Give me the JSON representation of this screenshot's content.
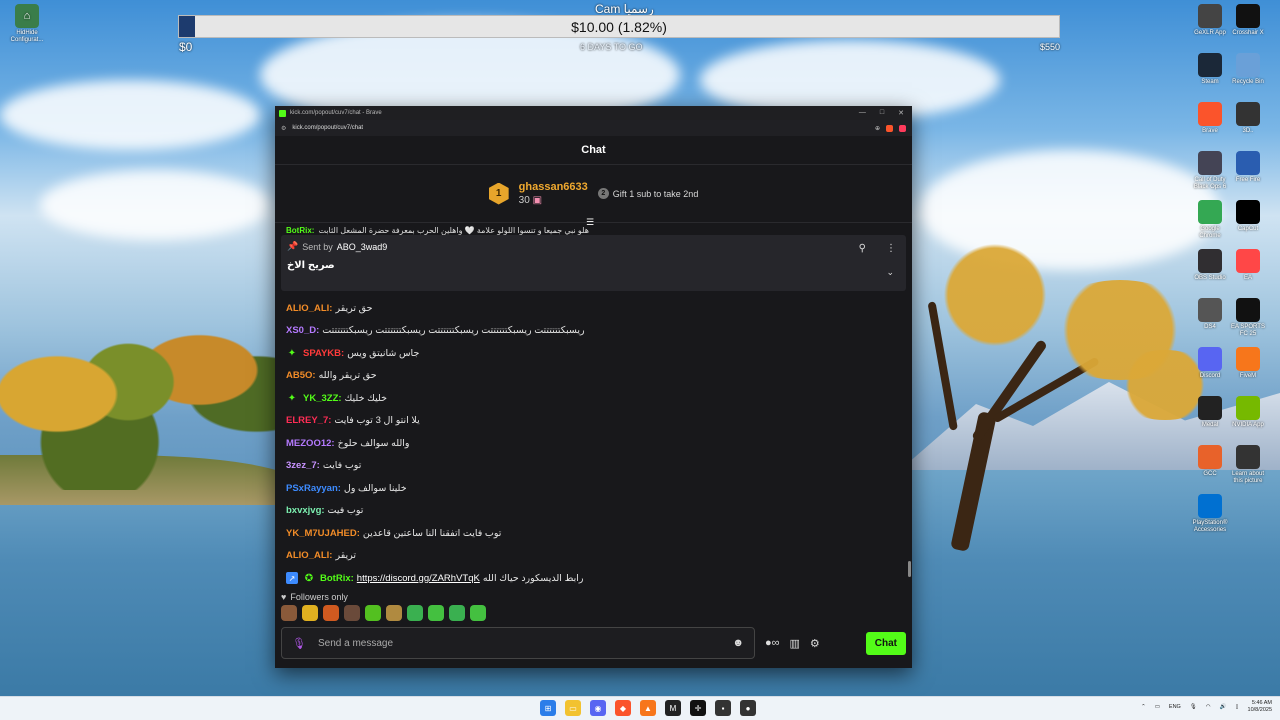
{
  "donation": {
    "title": "Cam رسميا",
    "amount_label": "$10.00 (1.82%)",
    "progress_fraction": 0.0182,
    "min_label": "$0",
    "max_label": "$550",
    "sub_label": "6 DAYS TO GO"
  },
  "desktop_left": {
    "hidhide": "HidHide Configurat..."
  },
  "desktop_right": [
    {
      "label": "GeXLR App",
      "color": "#444"
    },
    {
      "label": "Crosshair X",
      "color": "#111"
    },
    {
      "label": "Steam",
      "color": "#1b2838"
    },
    {
      "label": "Recycle Bin",
      "color": "#6aa0d8"
    },
    {
      "label": "Brave",
      "color": "#fb542b"
    },
    {
      "label": "3D..",
      "color": "#333"
    },
    {
      "label": "Call of Duty Black Ops 6",
      "color": "#445"
    },
    {
      "label": "Free Fire",
      "color": "#2a5db0"
    },
    {
      "label": "Google Chrome",
      "color": "#34a853"
    },
    {
      "label": "CapCut",
      "color": "#000"
    },
    {
      "label": "OBS Studio",
      "color": "#302e31"
    },
    {
      "label": "EA",
      "color": "#ff4747"
    },
    {
      "label": "DS4",
      "color": "#555"
    },
    {
      "label": "EA SPORTS FC 25",
      "color": "#111"
    },
    {
      "label": "Discord",
      "color": "#5865f2"
    },
    {
      "label": "FiveM",
      "color": "#f7761b"
    },
    {
      "label": "Medal",
      "color": "#222"
    },
    {
      "label": "NVIDIA App",
      "color": "#76b900"
    },
    {
      "label": "GCC",
      "color": "#e8622a"
    },
    {
      "label": "Learn about this picture",
      "color": "#333"
    },
    {
      "label": "PlayStation® Accessories",
      "color": "#0070d1"
    }
  ],
  "browser": {
    "title": "kick.com/popout/cuv7/chat - Brave",
    "url": "kick.com/popout/cuv7/chat"
  },
  "chat": {
    "header": "Chat",
    "leader": {
      "rank": "1",
      "name": "ghassan6633",
      "count": "30"
    },
    "gift": {
      "num": "2",
      "text": "Gift 1 sub to take 2nd"
    },
    "cutoff_user": "BotRix:",
    "cutoff_text": "هلو نبي جميعا و تنسوا اللولو علامة 🤍 واهلين الحرب بمعرفة حضرة المشعل الثابت",
    "pinned": {
      "sent_by_label": "Sent by",
      "sent_by_user": "ABO_3wad9",
      "message": "صريح الاخ"
    },
    "messages": [
      {
        "user": "ALIO_ALI:",
        "color": "#f28c28",
        "text": "حق تريقر",
        "badge": ""
      },
      {
        "user": "XS0_D:",
        "color": "#b57aff",
        "text": "ريسبكتتتتتتت ريسبكتتتتتتت ريسبكتتتتتتت ريسبكتتتتتتت ريسبكتتتتتتت",
        "badge": ""
      },
      {
        "user": "SPAYKB:",
        "color": "#ff3b3b",
        "text": "جاس شانيتق ويس",
        "badge": "✦"
      },
      {
        "user": "AB5O:",
        "color": "#f28c28",
        "text": "حق تريقر والله",
        "badge": ""
      },
      {
        "user": "YK_3ZZ:",
        "color": "#53fc18",
        "text": "خليك خليك",
        "badge": "✦"
      },
      {
        "user": "ELREY_7:",
        "color": "#ff2d55",
        "text": "يلا انتو ال 3 توب فايت",
        "badge": ""
      },
      {
        "user": "MEZOO12:",
        "color": "#b57aff",
        "text": "والله سوالف حلوخ",
        "badge": ""
      },
      {
        "user": "3zez_7:",
        "color": "#c792ff",
        "text": "توب فايت",
        "badge": ""
      },
      {
        "user": "PSxRayyan:",
        "color": "#3d8bff",
        "text": "خلينا سوالف ول",
        "badge": ""
      },
      {
        "user": "bxvxjvg:",
        "color": "#7cf0b0",
        "text": "توب فيت",
        "badge": ""
      },
      {
        "user": "YK_M7UJAHED:",
        "color": "#f28c28",
        "text": "توب فايت اتفقنا النا ساعتين قاعدين",
        "badge": ""
      },
      {
        "user": "ALIO_ALI:",
        "color": "#f28c28",
        "text": "تريقر",
        "badge": ""
      },
      {
        "user": "BotRix:",
        "color": "#53fc18",
        "text": "رابط الديسكورد حياك الله",
        "badge": "bot",
        "link": "https://discord.gg/ZARhVTqK"
      }
    ],
    "followers_label": "Followers only",
    "input_placeholder": "Send a message",
    "chat_button": "Chat"
  },
  "taskbar": {
    "lang": "ENG",
    "time": "5:46 AM",
    "date": "10/8/2025"
  }
}
